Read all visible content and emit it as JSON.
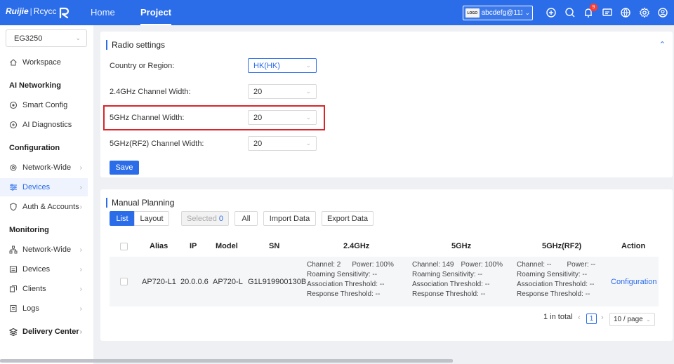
{
  "topbar": {
    "brand": "Ruijie",
    "brand_sep": "|",
    "brand_sub": "Rcycc",
    "nav": [
      {
        "label": "Home",
        "active": false
      },
      {
        "label": "Project",
        "active": true
      }
    ],
    "account": {
      "logo": "LOGO",
      "name": "abcdefg@111...."
    },
    "notification_count": "9",
    "icons": [
      "add-circle-icon",
      "search-icon",
      "bell-icon",
      "message-icon",
      "globe-icon",
      "gear-icon",
      "user-icon"
    ]
  },
  "sidebar": {
    "device_select": "EG3250",
    "workspace": "Workspace",
    "sections": {
      "ai": "AI Networking",
      "config": "Configuration",
      "monitoring": "Monitoring"
    },
    "items": {
      "smart_config": "Smart Config",
      "ai_diagnostics": "AI Diagnostics",
      "network_wide": "Network-Wide",
      "devices": "Devices",
      "auth_accounts": "Auth & Accounts",
      "mon_network_wide": "Network-Wide",
      "mon_devices": "Devices",
      "clients": "Clients",
      "logs": "Logs",
      "delivery_center": "Delivery Center"
    }
  },
  "radio_settings": {
    "title": "Radio settings",
    "fields": [
      {
        "label": "Country or Region:",
        "value": "HK(HK)"
      },
      {
        "label": "2.4GHz Channel Width:",
        "value": "20"
      },
      {
        "label": "5GHz Channel Width:",
        "value": "20"
      },
      {
        "label": "5GHz(RF2) Channel Width:",
        "value": "20"
      }
    ],
    "save": "Save"
  },
  "manual_planning": {
    "title": "Manual Planning",
    "tabs": {
      "list": "List",
      "layout": "Layout"
    },
    "selected_label": "Selected",
    "selected_count": "0",
    "all": "All",
    "import": "Import Data",
    "export": "Export Data",
    "columns": [
      "Alias",
      "IP",
      "Model",
      "SN",
      "2.4GHz",
      "5GHz",
      "5GHz(RF2)",
      "Action"
    ],
    "rows": [
      {
        "alias": "AP720-L1",
        "ip": "20.0.0.6",
        "model": "AP720-L",
        "sn": "G1L919900130B",
        "band24": {
          "channel": "Channel: 2",
          "power": "Power: 100%",
          "roaming": "Roaming Sensitivity: --",
          "assoc": "Association Threshold: --",
          "resp": "Response Threshold: --"
        },
        "band5": {
          "channel": "Channel: 149",
          "power": "Power: 100%",
          "roaming": "Roaming Sensitivity: --",
          "assoc": "Association Threshold: --",
          "resp": "Response Threshold: --"
        },
        "band5rf2": {
          "channel": "Channel: --",
          "power": "Power: --",
          "roaming": "Roaming Sensitivity: --",
          "assoc": "Association Threshold: --",
          "resp": "Response Threshold: --"
        },
        "action": "Configuration"
      }
    ],
    "pagination": {
      "total": "1 in total",
      "page": "1",
      "page_size": "10 / page"
    }
  },
  "colors": {
    "primary": "#2b6de8",
    "highlight": "#d9252a",
    "badge": "#ff3b30"
  }
}
